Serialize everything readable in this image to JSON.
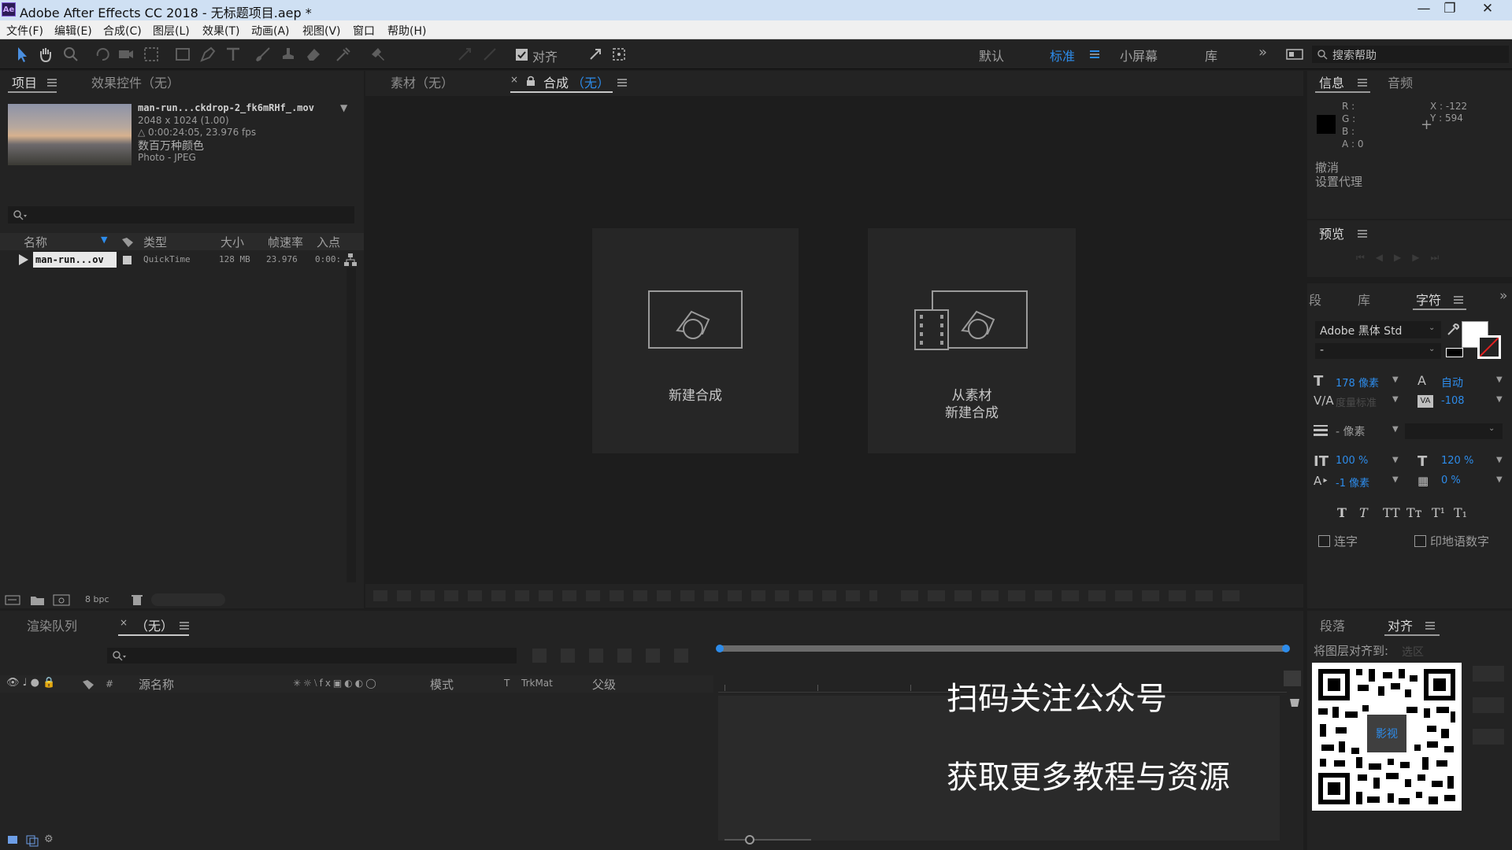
{
  "window": {
    "title": "Adobe After Effects CC 2018 - 无标题项目.aep *",
    "app_icon": "Ae",
    "controls": [
      "minimize-icon",
      "restore-icon",
      "close-icon"
    ]
  },
  "menu": [
    "文件(F)",
    "编辑(E)",
    "合成(C)",
    "图层(L)",
    "效果(T)",
    "动画(A)",
    "视图(V)",
    "窗口",
    "帮助(H)"
  ],
  "toolbar": {
    "align_label": "对齐",
    "workspaces": [
      "默认",
      "标准",
      "小屏幕",
      "库"
    ],
    "active_workspace": "标准",
    "search_placeholder": "搜索帮助"
  },
  "project_panel": {
    "tab_project": "项目",
    "tab_effects": "效果控件（无）",
    "footage": {
      "name": "man-run...ckdrop-2_fk6mRHf_.mov",
      "dims": "2048 x 1024 (1.00)",
      "duration": "△ 0:00:24:05, 23.976 fps",
      "colors": "数百万种颜色",
      "codec": "Photo - JPEG"
    },
    "columns": [
      "名称",
      "类型",
      "大小",
      "帧速率",
      "入点"
    ],
    "rows": [
      {
        "name": "man-run...ov",
        "type": "QuickTime",
        "size": "128 MB",
        "fps": "23.976",
        "in": "0:00:"
      }
    ],
    "bpc": "8 bpc"
  },
  "viewer": {
    "tab_footage": "素材（无）",
    "tab_comp_prefix": "合成",
    "tab_comp_value": "（无）",
    "new_comp_label": "新建合成",
    "from_footage_line1": "从素材",
    "from_footage_line2": "新建合成"
  },
  "info_panel": {
    "tab_info": "信息",
    "tab_audio": "音频",
    "r": "R :",
    "g": "G :",
    "b": "B :",
    "a": "A : 0",
    "x": "X : -122",
    "y": "Y : 594",
    "undo": "撤消",
    "proxy": "设置代理"
  },
  "preview_panel": {
    "tab": "预览"
  },
  "character_panel": {
    "tab_cut": "段",
    "tab_lib": "库",
    "tab_char": "字符",
    "font": "Adobe 黑体 Std",
    "style": "-",
    "size": "178 像素",
    "leading": "自动",
    "kerning": "度量标准",
    "tracking": "-108",
    "stroke": "- 像素",
    "vscale": "100 %",
    "hscale": "120 %",
    "baseline": "-1 像素",
    "tsume": "0 %",
    "styles": [
      "T",
      "T",
      "TT",
      "Tт",
      "T¹",
      "T₁"
    ],
    "ligature": "连字",
    "hindi": "印地语数字"
  },
  "bottom_right": {
    "tab_para": "段落",
    "tab_align": "对齐",
    "align_to": "将图层对齐到:",
    "align_to_value": "选区"
  },
  "timeline": {
    "tab_render": "渲染队列",
    "tab_comp": "（无）",
    "col_source": "源名称",
    "col_mode": "模式",
    "col_t": "T",
    "col_trkmat": "TrkMat",
    "col_parent": "父级"
  },
  "overlay": {
    "line1": "扫码关注公众号",
    "line2": "获取更多教程与资源",
    "qr_center": "影视"
  },
  "colors": {
    "accent_blue": "#2d8ceb",
    "panel_bg": "#232323",
    "app_bg": "#1d1d1d"
  }
}
